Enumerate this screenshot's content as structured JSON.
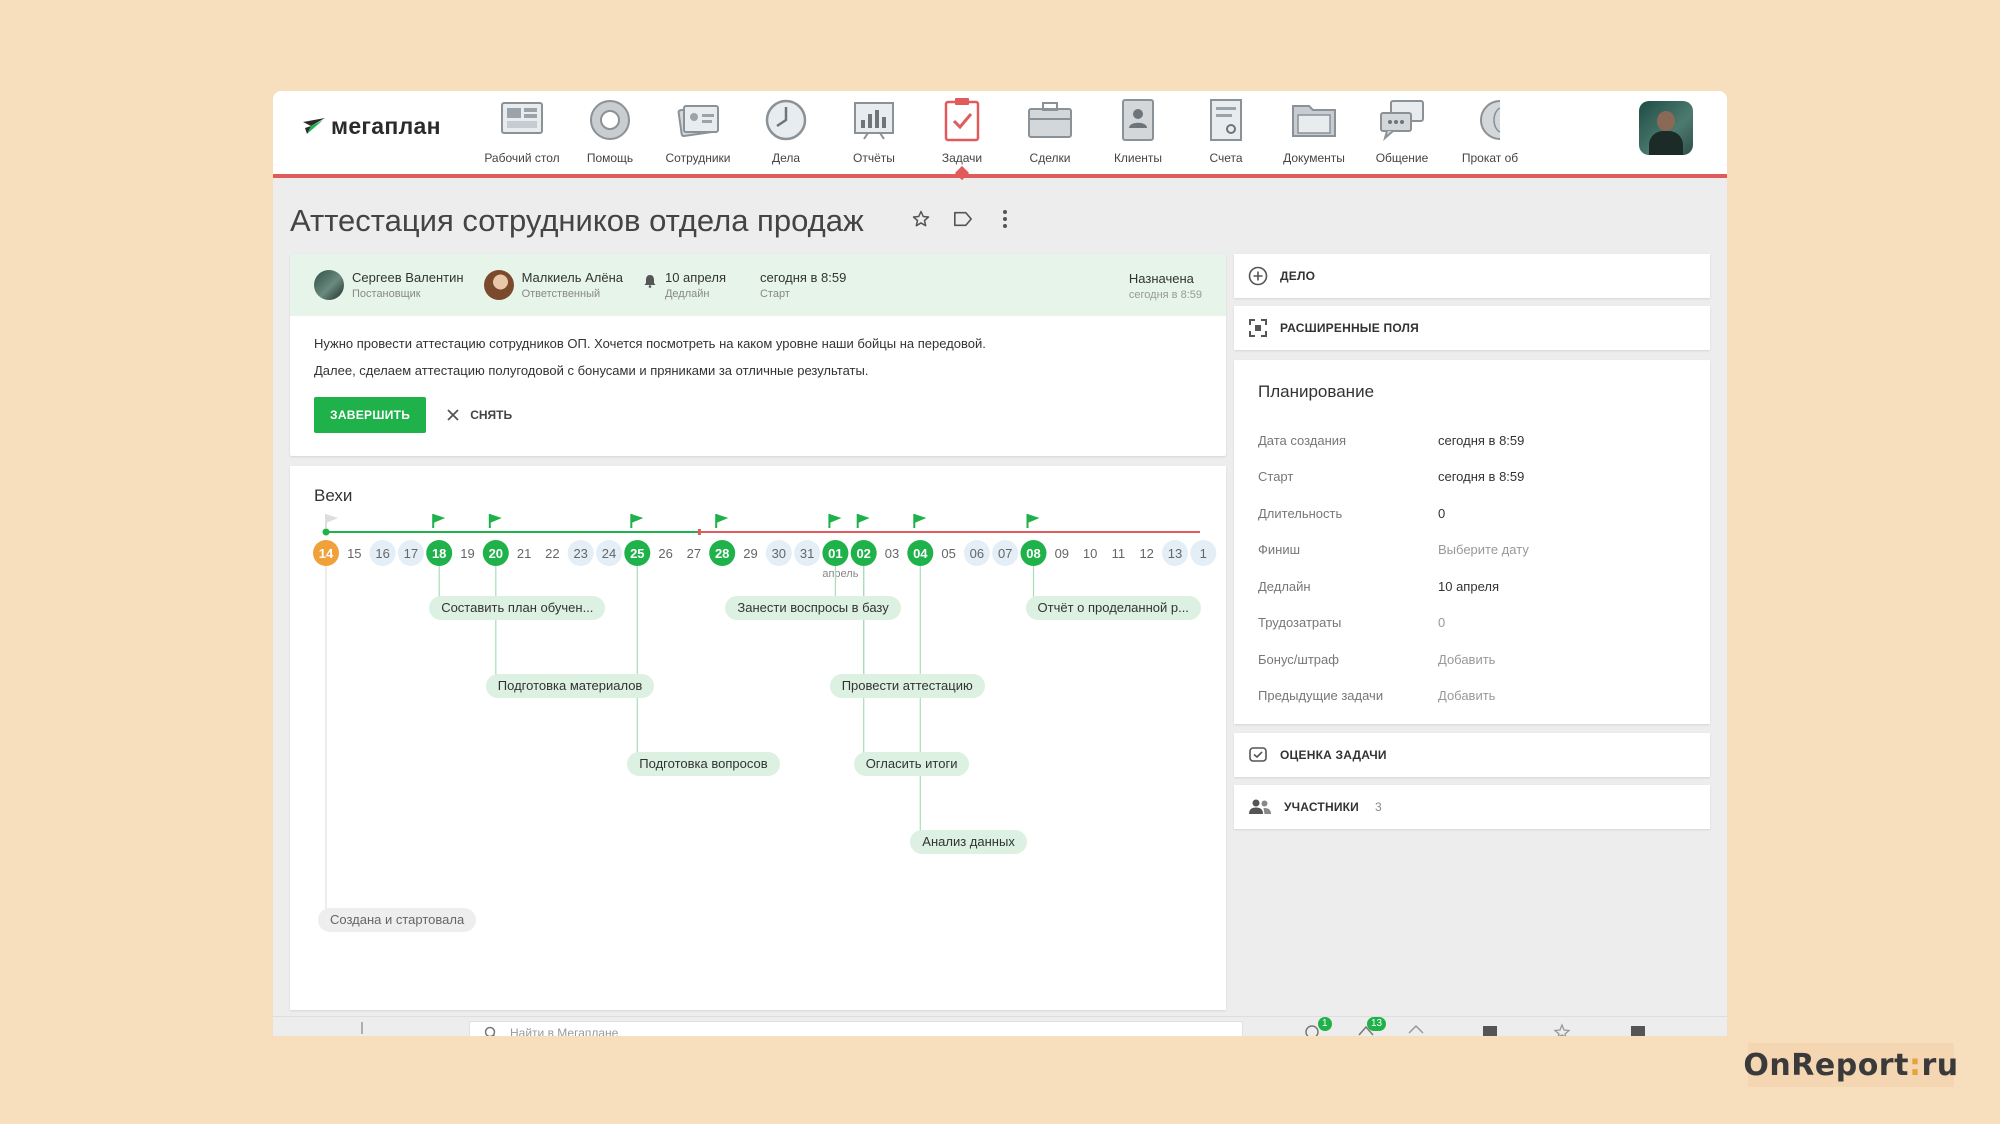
{
  "app": {
    "logo_text": "мегаплан",
    "nav": [
      {
        "label": "Рабочий стол",
        "icon": "desktop-icon"
      },
      {
        "label": "Помощь",
        "icon": "lifebuoy-icon"
      },
      {
        "label": "Сотрудники",
        "icon": "employees-icon"
      },
      {
        "label": "Дела",
        "icon": "clock-icon"
      },
      {
        "label": "Отчёты",
        "icon": "reports-icon"
      },
      {
        "label": "Задачи",
        "icon": "tasks-icon",
        "active": true
      },
      {
        "label": "Сделки",
        "icon": "briefcase-icon"
      },
      {
        "label": "Клиенты",
        "icon": "clients-icon"
      },
      {
        "label": "Счета",
        "icon": "invoice-icon"
      },
      {
        "label": "Документы",
        "icon": "folder-icon"
      },
      {
        "label": "Общение",
        "icon": "chat-icon"
      },
      {
        "label": "Прокат об",
        "icon": "globe-icon"
      }
    ],
    "accent_color": "#e05b5b",
    "green_color": "#1fb14a"
  },
  "task": {
    "title": "Аттестация сотрудников отдела продаж",
    "owner": {
      "name": "Сергеев Валентин",
      "role": "Постановщик"
    },
    "responsible": {
      "name": "Малкиель Алёна",
      "role": "Ответственный"
    },
    "deadline": {
      "value": "10 апреля",
      "label": "Дедлайн"
    },
    "start": {
      "value": "сегодня в 8:59",
      "label": "Старт"
    },
    "status": {
      "value": "Назначена",
      "sub": "сегодня в 8:59"
    },
    "description": [
      "Нужно провести аттестацию сотрудников ОП. Хочется посмотреть на каком уровне наши бойцы на передовой.",
      "Далее, сделаем аттестацию полугодовой с бонусами и пряниками за отличные результаты."
    ],
    "finish_button": "ЗАВЕРШИТЬ",
    "remove_button": "СНЯТЬ"
  },
  "milestones": {
    "title": "Вехи",
    "month_label": "апрель",
    "days": [
      "14",
      "15",
      "16",
      "17",
      "18",
      "19",
      "20",
      "21",
      "22",
      "23",
      "24",
      "25",
      "26",
      "27",
      "28",
      "29",
      "30",
      "31",
      "01",
      "02",
      "03",
      "04",
      "05",
      "06",
      "07",
      "08",
      "09",
      "10",
      "11",
      "12",
      "13",
      "1"
    ],
    "today": "14",
    "milestone_days": [
      "18",
      "20",
      "25",
      "28",
      "01",
      "02",
      "04",
      "08"
    ],
    "weekend_days": [
      "16",
      "17",
      "23",
      "24",
      "30",
      "31",
      "06",
      "07",
      "13",
      "1"
    ],
    "items": [
      {
        "label": "Составить план обучен...",
        "day": "18"
      },
      {
        "label": "Занести воспросы в базу",
        "day": "01"
      },
      {
        "label": "Отчёт о проделанной р...",
        "day": "08"
      },
      {
        "label": "Подготовка материалов",
        "day": "20"
      },
      {
        "label": "Провести аттестацию",
        "day": "02"
      },
      {
        "label": "Подготовка вопросов",
        "day": "25"
      },
      {
        "label": "Огласить итоги",
        "day": "02"
      },
      {
        "label": "Анализ данных",
        "day": "04"
      },
      {
        "label": "Создана и стартовала",
        "day": "14"
      }
    ]
  },
  "sidebar": {
    "add_action": "ДЕЛО",
    "extended_fields": "РАСШИРЕННЫЕ ПОЛЯ",
    "planning": {
      "title": "Планирование",
      "rows": [
        {
          "k": "Дата создания",
          "v": "сегодня в 8:59"
        },
        {
          "k": "Старт",
          "v": "сегодня в 8:59"
        },
        {
          "k": "Длительность",
          "v": "0"
        },
        {
          "k": "Финиш",
          "v": "Выберите дату",
          "placeholder": true
        },
        {
          "k": "Дедлайн",
          "v": "10 апреля"
        },
        {
          "k": "Трудозатраты",
          "v": "0",
          "placeholder": true
        },
        {
          "k": "Бонус/штраф",
          "v": "Добавить",
          "placeholder": true
        },
        {
          "k": "Предыдущие задачи",
          "v": "Добавить",
          "placeholder": true
        }
      ]
    },
    "task_rating": "ОЦЕНКА ЗАДАЧИ",
    "participants": {
      "label": "УЧАСТНИКИ",
      "count": "3"
    }
  },
  "bottom": {
    "search_placeholder": "Найти в Мегаплане",
    "badge_1": "1",
    "badge_2": "13"
  },
  "watermark": {
    "left": "OnReport",
    "dot": ":",
    "right": "ru"
  }
}
